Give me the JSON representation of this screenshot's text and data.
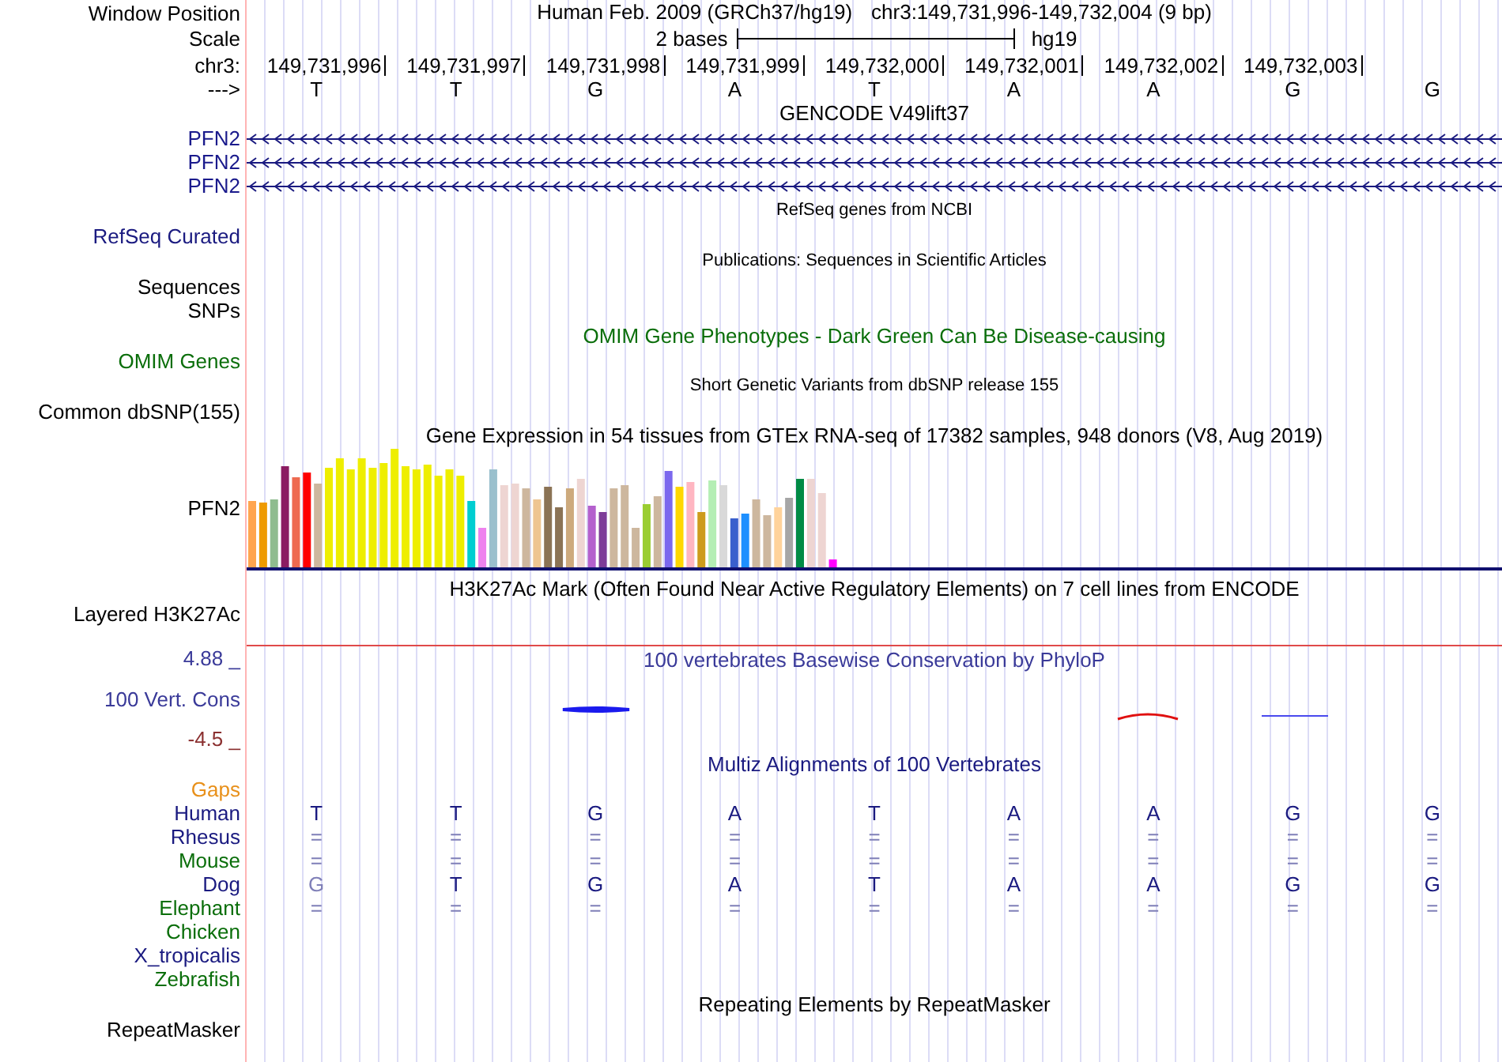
{
  "window_position": {
    "label": "Window Position",
    "assembly": "Human Feb. 2009 (GRCh37/hg19)",
    "position": "chr3:149,731,996-149,732,004 (9 bp)"
  },
  "scale": {
    "label": "Scale",
    "span": "2 bases",
    "db": "hg19"
  },
  "coordinates": {
    "label": "chr3:",
    "ticks": [
      "149,731,996",
      "149,731,997",
      "149,731,998",
      "149,731,999",
      "149,732,000",
      "149,732,001",
      "149,732,002",
      "149,732,003"
    ]
  },
  "sequence": {
    "label": "--->",
    "bases": [
      "T",
      "T",
      "G",
      "A",
      "T",
      "A",
      "A",
      "G",
      "G"
    ]
  },
  "tracks": [
    {
      "kind": "gene",
      "title": "GENCODE V49lift37",
      "items": [
        {
          "label": "PFN2",
          "color": "#1a1a8c"
        },
        {
          "label": "PFN2",
          "color": "#1a1a8c"
        },
        {
          "label": "PFN2",
          "color": "#1a1a8c"
        }
      ]
    },
    {
      "kind": "group",
      "title": "RefSeq genes from NCBI",
      "items": [
        {
          "label": "RefSeq Curated",
          "color": "#1a1a80"
        }
      ]
    },
    {
      "kind": "group",
      "title": "Publications: Sequences in Scientific Articles",
      "items": [
        {
          "label": "Sequences",
          "color": "#000000"
        },
        {
          "label": "SNPs",
          "color": "#000000"
        }
      ]
    },
    {
      "kind": "full",
      "title": "OMIM Gene Phenotypes - Dark Green Can Be Disease-causing",
      "items": [
        {
          "label": "OMIM Genes",
          "color": "#0a6e0a"
        }
      ]
    },
    {
      "kind": "group",
      "title": "Short Genetic Variants from dbSNP release 155",
      "items": [
        {
          "label": "Common dbSNP(155)",
          "color": "#000000"
        }
      ]
    },
    {
      "kind": "expression",
      "title": "Gene Expression in 54 tissues from GTEx RNA-seq of 17382 samples, 948 donors (V8, Aug 2019)",
      "items": [
        {
          "label": "PFN2",
          "color": "#000000"
        }
      ]
    },
    {
      "kind": "signal",
      "title": "H3K27Ac Mark (Often Found Near Active Regulatory Elements) on 7 cell lines from ENCODE",
      "items": [
        {
          "label": "Layered H3K27Ac",
          "color": "#000000"
        }
      ]
    },
    {
      "kind": "conservation",
      "title": "100 vertebrates Basewise Conservation by PhyloP",
      "max": "4.88 _",
      "min": "-4.5 _",
      "items": [
        {
          "label": "100 Vert. Cons",
          "color": "#3a3a99"
        }
      ]
    },
    {
      "kind": "alignment",
      "title": "Multiz Alignments of 100 Vertebrates",
      "items": [
        {
          "label": "Gaps",
          "color": "#e8901a"
        },
        {
          "label": "Human",
          "color": "#1a1a80",
          "cells": [
            {
              "text": "T",
              "dim": false
            },
            {
              "text": "T",
              "dim": false
            },
            {
              "text": "G",
              "dim": false
            },
            {
              "text": "A",
              "dim": false
            },
            {
              "text": "T",
              "dim": false
            },
            {
              "text": "A",
              "dim": false
            },
            {
              "text": "A",
              "dim": false
            },
            {
              "text": "G",
              "dim": false
            },
            {
              "text": "G",
              "dim": false
            }
          ]
        },
        {
          "label": "Rhesus",
          "color": "#1a1a80",
          "cells": [
            {
              "text": "=",
              "dim": true
            },
            {
              "text": "=",
              "dim": true
            },
            {
              "text": "=",
              "dim": true
            },
            {
              "text": "=",
              "dim": true
            },
            {
              "text": "=",
              "dim": true
            },
            {
              "text": "=",
              "dim": true
            },
            {
              "text": "=",
              "dim": true
            },
            {
              "text": "=",
              "dim": true
            },
            {
              "text": "=",
              "dim": true
            }
          ]
        },
        {
          "label": "Mouse",
          "color": "#0a6e0a",
          "cells": [
            {
              "text": "=",
              "dim": true
            },
            {
              "text": "=",
              "dim": true
            },
            {
              "text": "=",
              "dim": true
            },
            {
              "text": "=",
              "dim": true
            },
            {
              "text": "=",
              "dim": true
            },
            {
              "text": "=",
              "dim": true
            },
            {
              "text": "=",
              "dim": true
            },
            {
              "text": "=",
              "dim": true
            },
            {
              "text": "=",
              "dim": true
            }
          ]
        },
        {
          "label": "Dog",
          "color": "#1a1a80",
          "cells": [
            {
              "text": "G",
              "dim": true
            },
            {
              "text": "T",
              "dim": false
            },
            {
              "text": "G",
              "dim": false
            },
            {
              "text": "A",
              "dim": false
            },
            {
              "text": "T",
              "dim": false
            },
            {
              "text": "A",
              "dim": false
            },
            {
              "text": "A",
              "dim": false
            },
            {
              "text": "G",
              "dim": false
            },
            {
              "text": "G",
              "dim": false
            }
          ]
        },
        {
          "label": "Elephant",
          "color": "#0a6e0a",
          "cells": [
            {
              "text": "=",
              "dim": true
            },
            {
              "text": "=",
              "dim": true
            },
            {
              "text": "=",
              "dim": true
            },
            {
              "text": "=",
              "dim": true
            },
            {
              "text": "=",
              "dim": true
            },
            {
              "text": "=",
              "dim": true
            },
            {
              "text": "=",
              "dim": true
            },
            {
              "text": "=",
              "dim": true
            },
            {
              "text": "=",
              "dim": true
            }
          ]
        },
        {
          "label": "Chicken",
          "color": "#0a6e0a"
        },
        {
          "label": "X_tropicalis",
          "color": "#1a1a80"
        },
        {
          "label": "Zebrafish",
          "color": "#0a6e0a"
        }
      ]
    },
    {
      "kind": "plain",
      "title": "Repeating Elements by RepeatMasker",
      "items": [
        {
          "label": "RepeatMasker",
          "color": "#000000"
        }
      ]
    }
  ]
}
